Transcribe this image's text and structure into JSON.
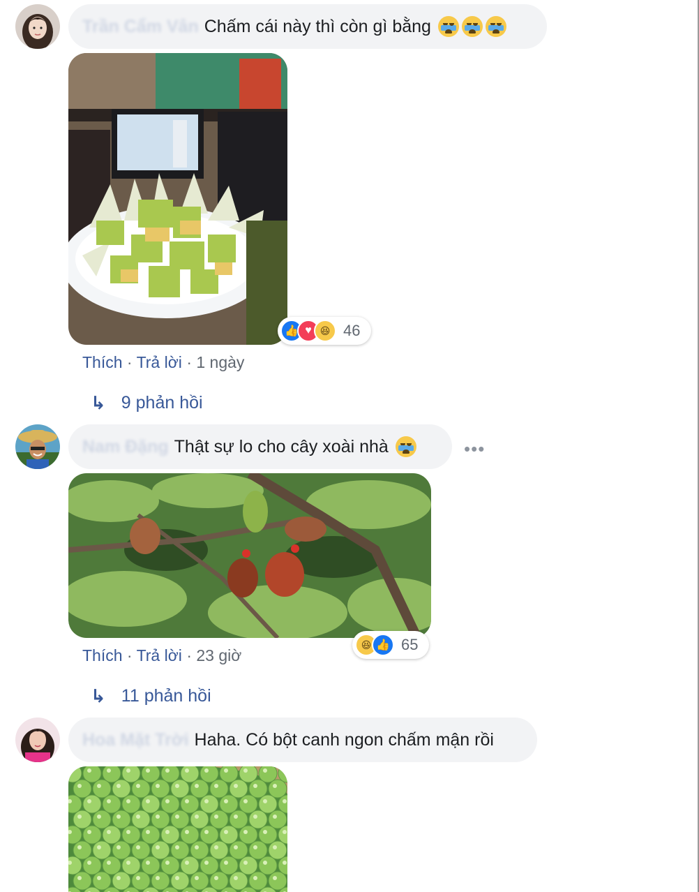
{
  "comments": [
    {
      "author": "Trần Cẩm Vân",
      "text": "Chấm cái này thì còn gì bằng",
      "emojis": [
        "crying-face-emoji",
        "crying-face-emoji",
        "crying-face-emoji"
      ],
      "photo": "sliced-guava-plate",
      "reaction_types": [
        "like",
        "love",
        "haha"
      ],
      "reaction_count": "46",
      "like_label": "Thích",
      "reply_label": "Trả lời",
      "time": "1 ngày",
      "replies": "9 phản hồi"
    },
    {
      "author": "Nam Đặng",
      "text": "Thật sự lo cho cây xoài nhà",
      "emojis": [
        "crying-face-emoji"
      ],
      "photo": "chickens-in-mango-tree",
      "reaction_types": [
        "haha",
        "like"
      ],
      "reaction_count": "65",
      "like_label": "Thích",
      "reply_label": "Trả lời",
      "time": "23 giờ",
      "replies": "11 phản hồi",
      "more_label": "•••"
    },
    {
      "author": "Hoa Mặt Trời",
      "text": "Haha. Có bột canh ngon chấm mận rồi",
      "photo": "green-plums-basket"
    }
  ],
  "separator": "·",
  "reply_arrow": "↳",
  "colors": {
    "link": "#385898",
    "bubble": "#f2f3f5",
    "meta": "#606770",
    "like": "#1877f2",
    "love": "#f33e58",
    "haha": "#f7c94a"
  }
}
